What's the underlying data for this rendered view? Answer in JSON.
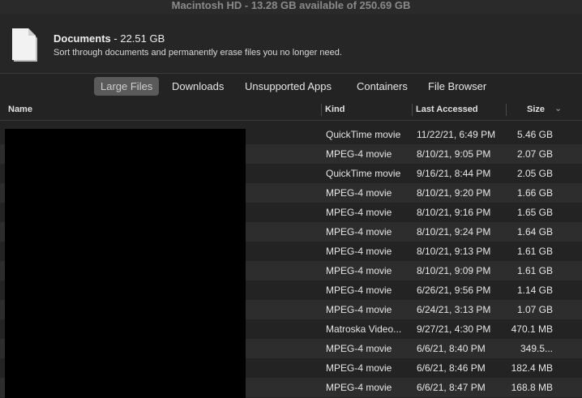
{
  "window": {
    "title": "Macintosh HD - 13.28 GB available of 250.69 GB"
  },
  "header": {
    "icon": "document-icon",
    "title": "Documents",
    "size": " - 22.51 GB",
    "subtitle": "Sort through documents and permanently erase files you no longer need."
  },
  "tabs": [
    {
      "label": "Large Files",
      "active": true
    },
    {
      "label": "Downloads",
      "active": false
    },
    {
      "label": "Unsupported Apps",
      "active": false
    },
    {
      "label": "Containers",
      "active": false
    },
    {
      "label": "File Browser",
      "active": false
    }
  ],
  "columns": {
    "name": "Name",
    "kind": "Kind",
    "last_accessed": "Last Accessed",
    "size": "Size"
  },
  "rows": [
    {
      "kind": "QuickTime movie",
      "date": "11/22/21, 6:49 PM",
      "size": "5.46 GB"
    },
    {
      "kind": "MPEG-4 movie",
      "date": "8/10/21, 9:05 PM",
      "size": "2.07 GB"
    },
    {
      "kind": "QuickTime movie",
      "date": "9/16/21, 8:44 PM",
      "size": "2.05 GB"
    },
    {
      "kind": "MPEG-4 movie",
      "date": "8/10/21, 9:20 PM",
      "size": "1.66 GB"
    },
    {
      "kind": "MPEG-4 movie",
      "date": "8/10/21, 9:16 PM",
      "size": "1.65 GB"
    },
    {
      "kind": "MPEG-4 movie",
      "date": "8/10/21, 9:24 PM",
      "size": "1.64 GB"
    },
    {
      "kind": "MPEG-4 movie",
      "date": "8/10/21, 9:13 PM",
      "size": "1.61 GB"
    },
    {
      "kind": "MPEG-4 movie",
      "date": "8/10/21, 9:09 PM",
      "size": "1.61 GB"
    },
    {
      "kind": "MPEG-4 movie",
      "date": "6/26/21, 9:56 PM",
      "size": "1.14 GB"
    },
    {
      "kind": "MPEG-4 movie",
      "date": "6/24/21, 3:13 PM",
      "size": "1.07 GB"
    },
    {
      "kind": "Matroska Video...",
      "date": "9/27/21, 4:30 PM",
      "size": "470.1 MB"
    },
    {
      "kind": "MPEG-4 movie",
      "date": "6/6/21, 8:40 PM",
      "size": "349.5..."
    },
    {
      "kind": "MPEG-4 movie",
      "date": "6/6/21, 8:46 PM",
      "size": "182.4 MB"
    },
    {
      "kind": "MPEG-4 movie",
      "date": "6/6/21, 8:47 PM",
      "size": "168.8 MB"
    }
  ],
  "colors": {
    "background": "#232323",
    "alt_row": "#2d2d2d",
    "active_tab": "#5a5a5a"
  }
}
